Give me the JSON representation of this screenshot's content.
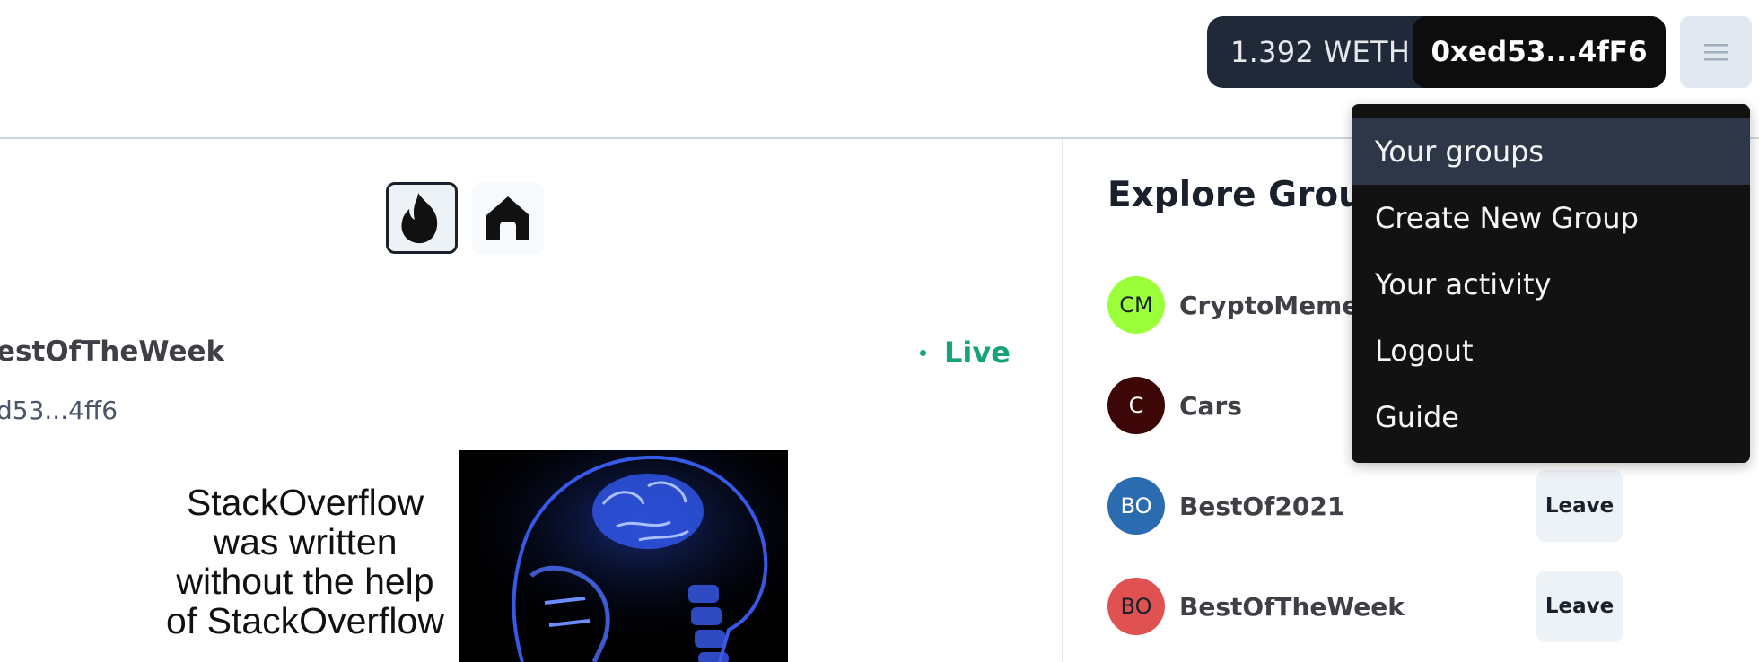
{
  "header": {
    "balance": "1.392 WETH",
    "address": "0xed53...4fF6",
    "menu_icon": "hamburger-icon"
  },
  "tabs": [
    {
      "icon": "flame-icon",
      "active": true
    },
    {
      "icon": "home-icon",
      "active": false
    }
  ],
  "post": {
    "group": "estOfTheWeek",
    "author": "d53...4ff6",
    "status": "Live",
    "meme_caption": "StackOverflow\nwas written\nwithout the help\nof StackOverflow"
  },
  "sidebar": {
    "title": "Explore Groups",
    "groups": [
      {
        "initials": "CM",
        "name": "CryptoMemes",
        "color": "#9bff3a",
        "text_color": "#1a202c"
      },
      {
        "initials": "C",
        "name": "Cars",
        "color": "#3d0707",
        "text_color": "#ffffff"
      },
      {
        "initials": "BO",
        "name": "BestOf2021",
        "color": "#2b6cb0",
        "text_color": "#ffffff",
        "action": "Leave"
      },
      {
        "initials": "BO",
        "name": "BestOfTheWeek",
        "color": "#e05252",
        "text_color": "#1a202c",
        "action": "Leave"
      }
    ]
  },
  "dropdown": {
    "items": [
      "Your groups",
      "Create New Group",
      "Your activity",
      "Logout",
      "Guide"
    ]
  },
  "colors": {
    "live": "#16a37a",
    "wallet_bg": "#1f2937",
    "dropdown_bg": "#121212"
  }
}
